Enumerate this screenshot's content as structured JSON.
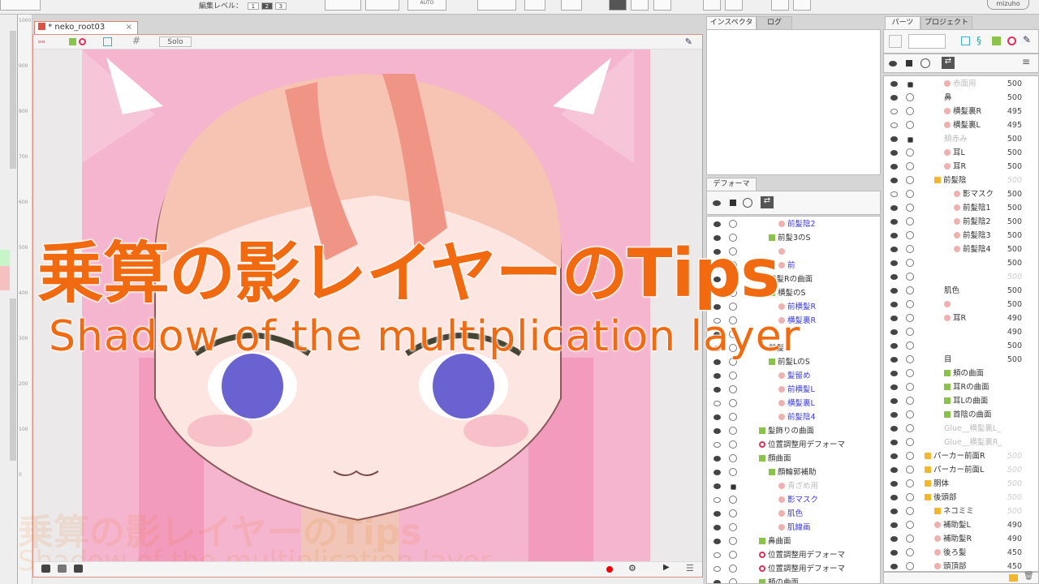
{
  "toolbar": {
    "edit_level_label": "編集レベル：",
    "levels": [
      "1",
      "2",
      "3"
    ],
    "active_level": "2",
    "auto_label": "AUTO",
    "brand": "mizuho"
  },
  "ruler": {
    "ticks": [
      "1000",
      "900",
      "800",
      "700",
      "600",
      "500",
      "400",
      "300",
      "200",
      "100",
      "0"
    ]
  },
  "view": {
    "tab_label": "* neko_root03",
    "close": "×",
    "solo_label": "Solo"
  },
  "overlay": {
    "title": "乗算の影レイヤーのTips",
    "subtitle": "Shadow of the multiplication layer"
  },
  "inspector": {
    "tabs": [
      "インスペクタ",
      "ログ"
    ]
  },
  "deformer": {
    "tab": "デフォーマ",
    "rows": [
      {
        "eye": true,
        "label": "前髪陰2",
        "style": "blue",
        "indent": 4,
        "icon": "mesh"
      },
      {
        "eye": true,
        "label": "前髪3のS",
        "style": "",
        "indent": 3,
        "icon": "grid"
      },
      {
        "eye": true,
        "label": "",
        "style": "blue",
        "indent": 4,
        "icon": "mesh"
      },
      {
        "eye": true,
        "label": "前",
        "style": "blue",
        "indent": 4,
        "icon": "mesh"
      },
      {
        "eye": true,
        "label": "前髪Rの曲面",
        "style": "",
        "indent": 3,
        "icon": ""
      },
      {
        "eye": true,
        "label": "横髪のS",
        "style": "",
        "indent": 3,
        "icon": "grid"
      },
      {
        "eye": true,
        "label": "前横髪R",
        "style": "blue",
        "indent": 4,
        "icon": "mesh"
      },
      {
        "eye": false,
        "label": "横髪裏R",
        "style": "blue",
        "indent": 4,
        "icon": "mesh"
      },
      {
        "eye": true,
        "label": "",
        "style": "blue",
        "indent": 4,
        "icon": ""
      },
      {
        "eye": false,
        "label": "前髪",
        "style": "",
        "indent": 3,
        "icon": ""
      },
      {
        "eye": true,
        "label": "前髪LのS",
        "style": "",
        "indent": 3,
        "icon": "grid"
      },
      {
        "eye": true,
        "label": "髪留め",
        "style": "blue",
        "indent": 4,
        "icon": "mesh"
      },
      {
        "eye": true,
        "label": "前横髪L",
        "style": "blue",
        "indent": 4,
        "icon": "mesh"
      },
      {
        "eye": false,
        "label": "横髪裏L",
        "style": "blue",
        "indent": 4,
        "icon": "mesh"
      },
      {
        "eye": true,
        "label": "前髪陰4",
        "style": "blue",
        "indent": 4,
        "icon": "mesh"
      },
      {
        "eye": true,
        "label": "髪飾りの曲面",
        "style": "",
        "indent": 2,
        "icon": "grid"
      },
      {
        "eye": false,
        "label": "位置調整用デフォーマ",
        "style": "",
        "indent": 2,
        "icon": "rot"
      },
      {
        "eye": true,
        "label": "顔曲面",
        "style": "",
        "indent": 2,
        "icon": "grid"
      },
      {
        "eye": true,
        "label": "顔輪郭補助",
        "style": "",
        "indent": 3,
        "icon": "grid"
      },
      {
        "eye": true,
        "lock": true,
        "label": "青ざめ用",
        "style": "gray",
        "indent": 4,
        "icon": "mesh"
      },
      {
        "eye": false,
        "label": "影マスク",
        "style": "blue",
        "indent": 4,
        "icon": "mesh"
      },
      {
        "eye": true,
        "label": "肌色",
        "style": "blue",
        "indent": 4,
        "icon": "mesh"
      },
      {
        "eye": true,
        "label": "肌線画",
        "style": "blue",
        "indent": 4,
        "icon": "mesh"
      },
      {
        "eye": true,
        "label": "鼻曲面",
        "style": "",
        "indent": 2,
        "icon": "grid"
      },
      {
        "eye": false,
        "label": "位置調整用デフォーマ",
        "style": "",
        "indent": 2,
        "icon": "rot"
      },
      {
        "eye": false,
        "label": "位置調整用デフォーマ",
        "style": "",
        "indent": 2,
        "icon": "rot"
      },
      {
        "eye": true,
        "label": "頬の曲面",
        "style": "",
        "indent": 2,
        "icon": "grid"
      }
    ]
  },
  "parts": {
    "tabs": [
      "パーツ",
      "プロジェクト"
    ],
    "rows": [
      {
        "eye": true,
        "lock": true,
        "label": "赤面用",
        "num": "500",
        "style": "gray",
        "indent": 3,
        "icon": "mesh"
      },
      {
        "eye": true,
        "label": "鼻",
        "num": "500",
        "style": "",
        "indent": 3,
        "icon": ""
      },
      {
        "eye": false,
        "label": "横髪裏R",
        "num": "495",
        "style": "",
        "indent": 3,
        "icon": "mesh"
      },
      {
        "eye": false,
        "label": "横髪裏L",
        "num": "495",
        "style": "",
        "indent": 3,
        "icon": "mesh"
      },
      {
        "eye": true,
        "lock": true,
        "label": "頬赤み",
        "num": "500",
        "style": "gray",
        "indent": 3,
        "icon": ""
      },
      {
        "eye": true,
        "label": "耳L",
        "num": "500",
        "style": "",
        "indent": 3,
        "icon": "mesh"
      },
      {
        "eye": true,
        "label": "耳R",
        "num": "500",
        "style": "",
        "indent": 3,
        "icon": "mesh"
      },
      {
        "eye": true,
        "label": "前髪陰",
        "num": "500",
        "dim": true,
        "style": "",
        "indent": 2,
        "icon": "folder"
      },
      {
        "eye": false,
        "label": "影マスク",
        "num": "500",
        "style": "",
        "indent": 4,
        "icon": "mesh"
      },
      {
        "eye": true,
        "label": "前髪陰1",
        "num": "500",
        "style": "",
        "indent": 4,
        "icon": "mesh"
      },
      {
        "eye": true,
        "label": "前髪陰2",
        "num": "500",
        "style": "",
        "indent": 4,
        "icon": "mesh"
      },
      {
        "eye": true,
        "label": "前髪陰3",
        "num": "500",
        "style": "",
        "indent": 4,
        "icon": "mesh"
      },
      {
        "eye": true,
        "label": "前髪陰4",
        "num": "500",
        "style": "",
        "indent": 4,
        "icon": "mesh"
      },
      {
        "eye": true,
        "label": "",
        "num": "500",
        "style": "",
        "indent": 3,
        "icon": ""
      },
      {
        "eye": true,
        "label": "",
        "num": "500",
        "dim": true,
        "style": "",
        "indent": 3,
        "icon": ""
      },
      {
        "eye": true,
        "label": "肌色",
        "num": "500",
        "style": "",
        "indent": 3,
        "icon": ""
      },
      {
        "eye": true,
        "label": "",
        "num": "500",
        "style": "",
        "indent": 3,
        "icon": "mesh"
      },
      {
        "eye": true,
        "label": "耳R",
        "num": "490",
        "style": "",
        "indent": 3,
        "icon": "mesh"
      },
      {
        "eye": true,
        "label": "",
        "num": "490",
        "style": "",
        "indent": 3,
        "icon": ""
      },
      {
        "eye": true,
        "label": "",
        "num": "500",
        "style": "",
        "indent": 3,
        "icon": ""
      },
      {
        "eye": true,
        "label": "目",
        "num": "500",
        "style": "",
        "indent": 3,
        "icon": ""
      },
      {
        "eye": true,
        "label": "頬の曲面",
        "num": "",
        "style": "",
        "indent": 3,
        "icon": "grid"
      },
      {
        "eye": true,
        "label": "耳Rの曲面",
        "num": "",
        "style": "",
        "indent": 3,
        "icon": "grid"
      },
      {
        "eye": true,
        "label": "耳Lの曲面",
        "num": "",
        "style": "",
        "indent": 3,
        "icon": "grid"
      },
      {
        "eye": true,
        "label": "首陰の曲面",
        "num": "",
        "style": "",
        "indent": 3,
        "icon": "grid"
      },
      {
        "eye": true,
        "label": "Glue__横髪裏L_",
        "num": "",
        "style": "gray",
        "indent": 3,
        "icon": ""
      },
      {
        "eye": true,
        "label": "Glue__横髪裏R_",
        "num": "",
        "style": "gray",
        "indent": 3,
        "icon": ""
      },
      {
        "eye": true,
        "label": "パーカー前面R",
        "num": "500",
        "dim": true,
        "style": "",
        "indent": 1,
        "icon": "folder"
      },
      {
        "eye": true,
        "label": "パーカー前面L",
        "num": "500",
        "dim": true,
        "style": "",
        "indent": 1,
        "icon": "folder"
      },
      {
        "eye": true,
        "label": "胴体",
        "num": "500",
        "dim": true,
        "style": "",
        "indent": 1,
        "icon": "folder"
      },
      {
        "eye": true,
        "label": "後頭部",
        "num": "500",
        "dim": true,
        "style": "",
        "indent": 1,
        "icon": "folder"
      },
      {
        "eye": true,
        "label": "ネコミミ",
        "num": "500",
        "dim": true,
        "style": "",
        "indent": 2,
        "icon": "folder"
      },
      {
        "eye": true,
        "label": "補助髪L",
        "num": "490",
        "style": "",
        "indent": 2,
        "icon": "mesh"
      },
      {
        "eye": true,
        "label": "補助髪R",
        "num": "490",
        "style": "",
        "indent": 2,
        "icon": "mesh"
      },
      {
        "eye": true,
        "label": "後ろ髪",
        "num": "450",
        "style": "",
        "indent": 2,
        "icon": "mesh"
      },
      {
        "eye": true,
        "label": "頭頂部",
        "num": "450",
        "style": "",
        "indent": 2,
        "icon": "mesh"
      }
    ]
  }
}
